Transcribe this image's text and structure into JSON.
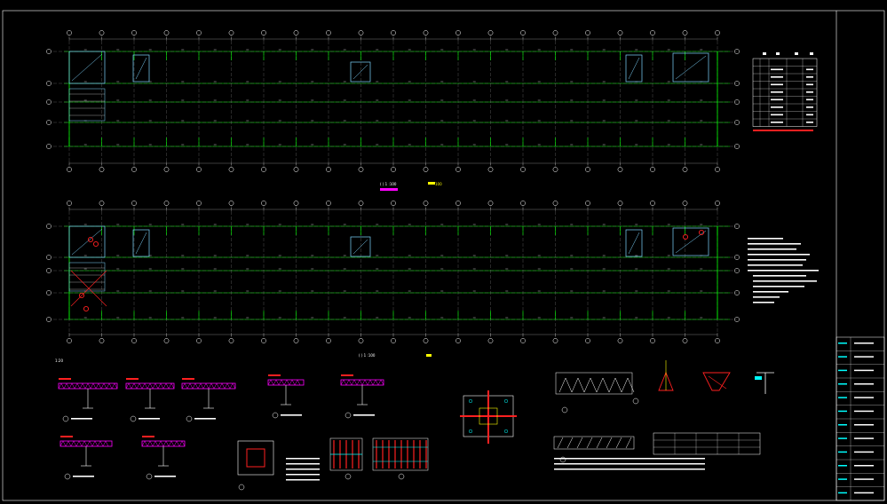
{
  "drawing": {
    "background": "#000000",
    "colors": {
      "grid": "#00ff00",
      "axis": "#ffffff",
      "wall": "#7fd6ff",
      "beam": "#ff00ff",
      "red": "#ff2020",
      "yellow": "#ffff00",
      "cyan": "#00ffff",
      "frame": "#ffffff"
    },
    "plan1": {
      "title": "( ) 1 :100",
      "note": "100"
    },
    "plan2": {
      "title": "( ) 1 :100"
    },
    "details_title": "1:20",
    "table1_header": [
      "",
      "",
      "",
      ""
    ],
    "table1_rows": 9,
    "title_block": {
      "rows": 12
    }
  }
}
